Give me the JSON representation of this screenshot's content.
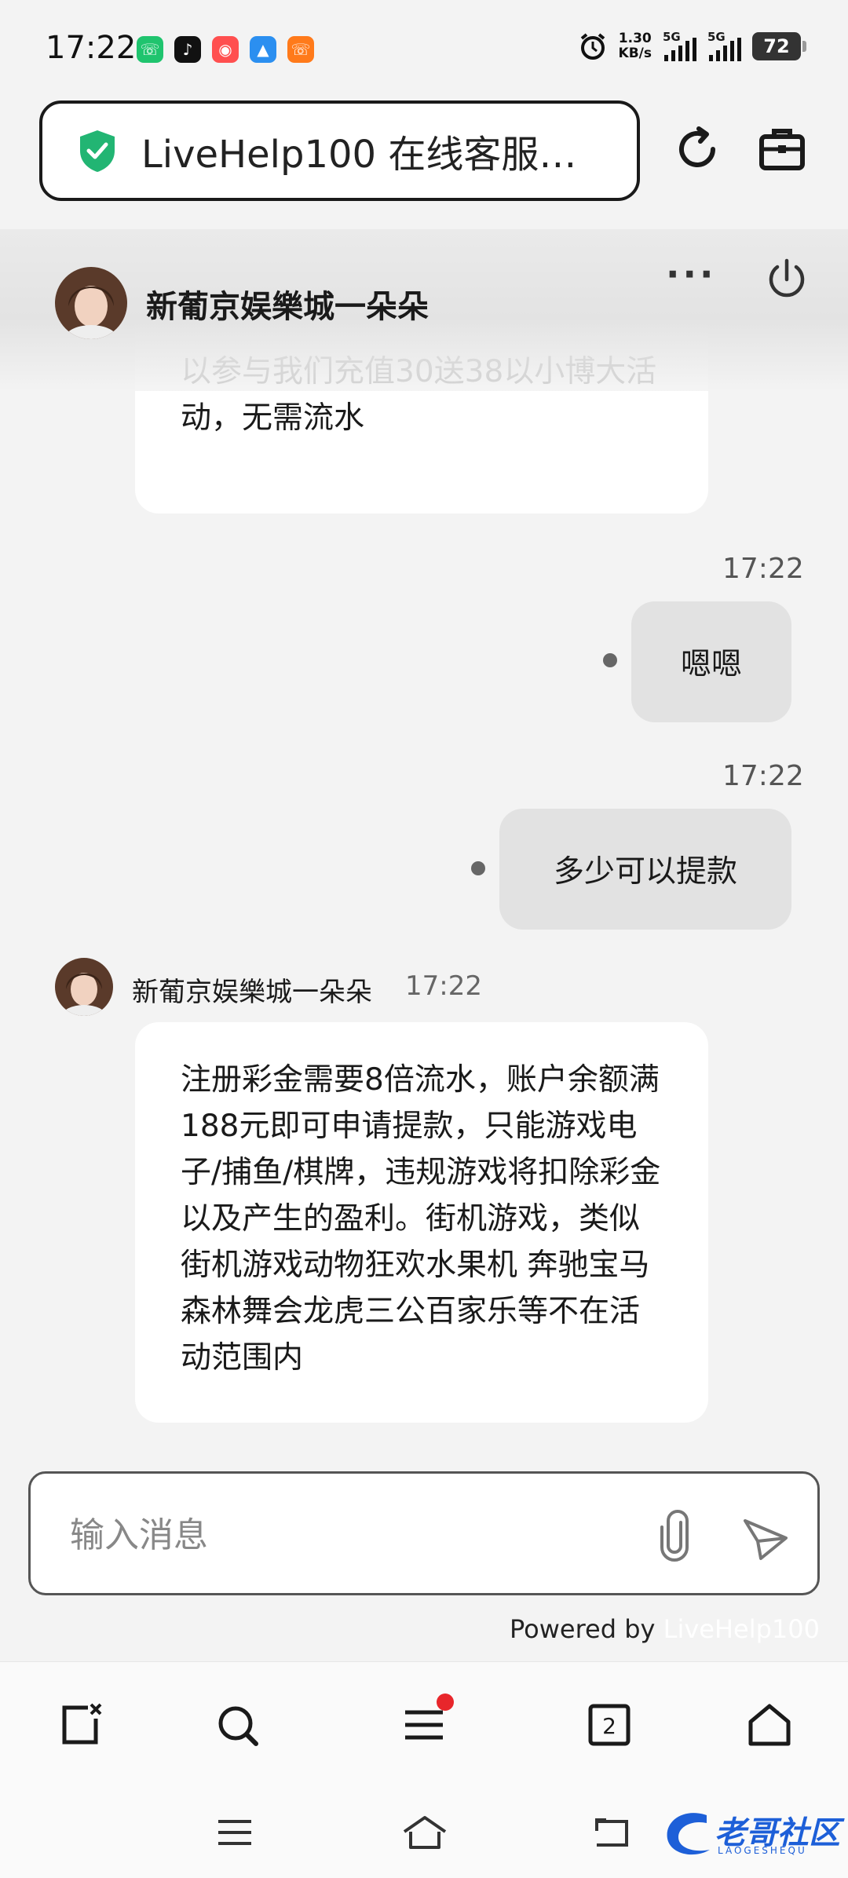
{
  "status_bar": {
    "time": "17:22",
    "net_speed_value": "1.30",
    "net_speed_unit": "KB/s",
    "sim1_label": "5G",
    "sim2_label": "5G",
    "battery": "72"
  },
  "browser": {
    "url_title": "LiveHelp100 在线客服…"
  },
  "chat_header": {
    "agent_name": "新葡京娱樂城一朵朵",
    "more_label": "···"
  },
  "messages": {
    "m1_visible": "以参与我们充值30送38以小博大活动，无需流水",
    "m2_time": "17:22",
    "m2_text": "嗯嗯",
    "m3_time": "17:22",
    "m3_text": "多少可以提款",
    "m4_sender": "新葡京娱樂城一朵朵",
    "m4_time": "17:22",
    "m4_text": "注册彩金需要8倍流水，账户余额满188元即可申请提款，只能游戏电子/捕鱼/棋牌，违规游戏将扣除彩金以及产生的盈利。街机游戏，类似街机游戏动物狂欢水果机 奔驰宝马森林舞会龙虎三公百家乐等不在活动范围内"
  },
  "composer": {
    "placeholder": "输入消息",
    "powered_prefix": "Powered by",
    "powered_brand": "LiveHelp100"
  },
  "bottom_nav": {
    "tab_count": "2"
  },
  "watermark": {
    "title": "老哥社区",
    "subtitle": "LAOGESHEQU"
  },
  "colors": {
    "shield_green": "#22b573",
    "badge_red": "#e8262b",
    "incoming_bubble": "#ffffff",
    "outgoing_bubble": "#e2e2e2"
  }
}
